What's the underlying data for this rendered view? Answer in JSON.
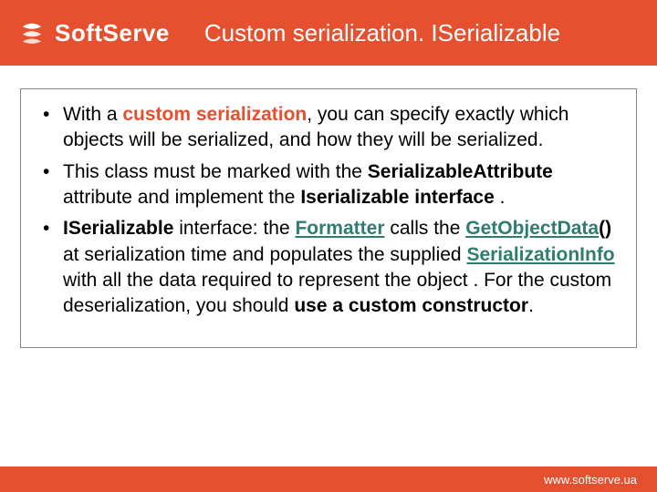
{
  "header": {
    "brand": "SoftServe",
    "title": "Custom serialization. ISerializable"
  },
  "bullets": {
    "b1": {
      "t1": "With a ",
      "t2": "custom serialization",
      "t3": ", you can specify exactly which objects will be serialized, and how they will be serialized."
    },
    "b2": {
      "t1": "This class must be marked with the ",
      "t2": "SerializableAttribute",
      "t3": " attribute and implement the ",
      "t4": "Iserializable interface",
      "t5": " ."
    },
    "b3": {
      "t1": "ISerializable",
      "t2": " interface: the ",
      "t3": "Formatter",
      "t4": " calls the ",
      "t5": "GetObjectData",
      "t6": "()",
      "t7": " at serialization time and populates the supplied ",
      "t8": "SerializationInfo",
      "t9": " with all the data required to represent the object . For the custom deserialization, you should ",
      "t10": "use a custom constructor",
      "t11": "."
    }
  },
  "footer": {
    "url": "www.softserve.ua"
  }
}
